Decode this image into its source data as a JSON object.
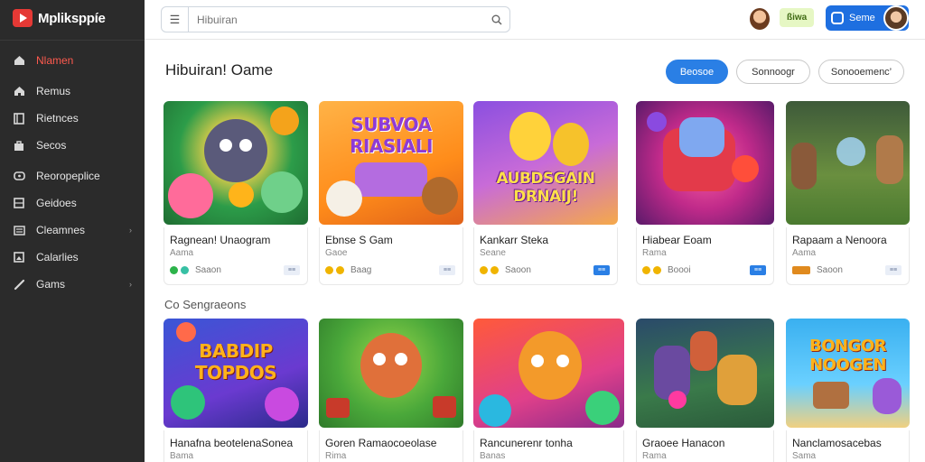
{
  "app": {
    "logo_text": "Mpliksppíe"
  },
  "search": {
    "placeholder": "Hibuiran"
  },
  "topbar": {
    "badge_label": "ßiwa",
    "user_label": "Seme"
  },
  "sidebar": {
    "items": [
      {
        "label": "Nlamen",
        "icon": "home-icon",
        "active": true
      },
      {
        "label": "Remus",
        "icon": "house-icon"
      },
      {
        "label": "Rietnces",
        "icon": "book-icon"
      },
      {
        "label": "Secos",
        "icon": "bag-icon"
      },
      {
        "label": "Reoropeplice",
        "icon": "gamepad-icon"
      },
      {
        "label": "Geidoes",
        "icon": "grid-icon"
      },
      {
        "label": "Cleamnes",
        "icon": "list-icon",
        "chevron": "›"
      },
      {
        "label": "Calarlies",
        "icon": "gallery-icon"
      },
      {
        "label": "Gams",
        "icon": "tool-icon",
        "chevron": "›"
      }
    ]
  },
  "main": {
    "title": "Hibuiran! Oame",
    "filters": [
      "Beosoe",
      "Sonnoogr",
      "Sonooemenc’"
    ],
    "subtitle": "Co Sengraeons"
  },
  "cards_row1": [
    {
      "title": "Ragnean! Unaogram",
      "subtitle": "Aama",
      "foot": "Saaon",
      "tag": "≡≡",
      "tag_style": "light",
      "dot_colors": [
        "#2cb34a",
        "#37c0a4"
      ],
      "art_text": ""
    },
    {
      "title": "Ebnse S Gam",
      "subtitle": "Gaoe",
      "foot": "Baag",
      "tag": "≡≡",
      "tag_style": "light",
      "dot_colors": [
        "#f0b400",
        "#f0b400"
      ],
      "art_text": "SUBVOA RIASIALI"
    },
    {
      "title": "Kankarr Steka",
      "subtitle": "Seane",
      "foot": "Saoon",
      "tag": "≡≡",
      "tag_style": "blue",
      "dot_colors": [
        "#f0b400",
        "#f0b400"
      ],
      "art_text": "AUBDSGAIN DRNAIJ!"
    },
    {
      "title": "Hiabear Eoam",
      "subtitle": "Rama",
      "foot": "Boooi",
      "tag": "≡≡",
      "tag_style": "blue",
      "dot_colors": [
        "#f0b400",
        "#f0b400"
      ],
      "art_text": ""
    },
    {
      "title": "Rapaam a Nenoora",
      "subtitle": "Aama",
      "foot": "Saoon",
      "tag": "≡≡",
      "tag_style": "light",
      "dot_colors": [
        "#e08a1e",
        "#e08a1e"
      ],
      "art_text": ""
    }
  ],
  "cards_row2": [
    {
      "title": "Hanafna beotelenaSonea",
      "subtitle": "Bama",
      "art_text": "BABDIP TOPDOS"
    },
    {
      "title": "Goren Ramaocoeolase",
      "subtitle": "Rima",
      "art_text": ""
    },
    {
      "title": "Rancunerenr tonha",
      "subtitle": "Banas",
      "art_text": ""
    },
    {
      "title": "Graoee Hanacon",
      "subtitle": "Rama",
      "art_text": ""
    },
    {
      "title": "Nanclamosacebas",
      "subtitle": "Sama",
      "art_text": "BONGOR NOOGEN"
    }
  ],
  "colors": {
    "accent": "#2a7fe5",
    "active_nav": "#ff5a4e",
    "sidebar_bg": "#2b2b2b"
  }
}
